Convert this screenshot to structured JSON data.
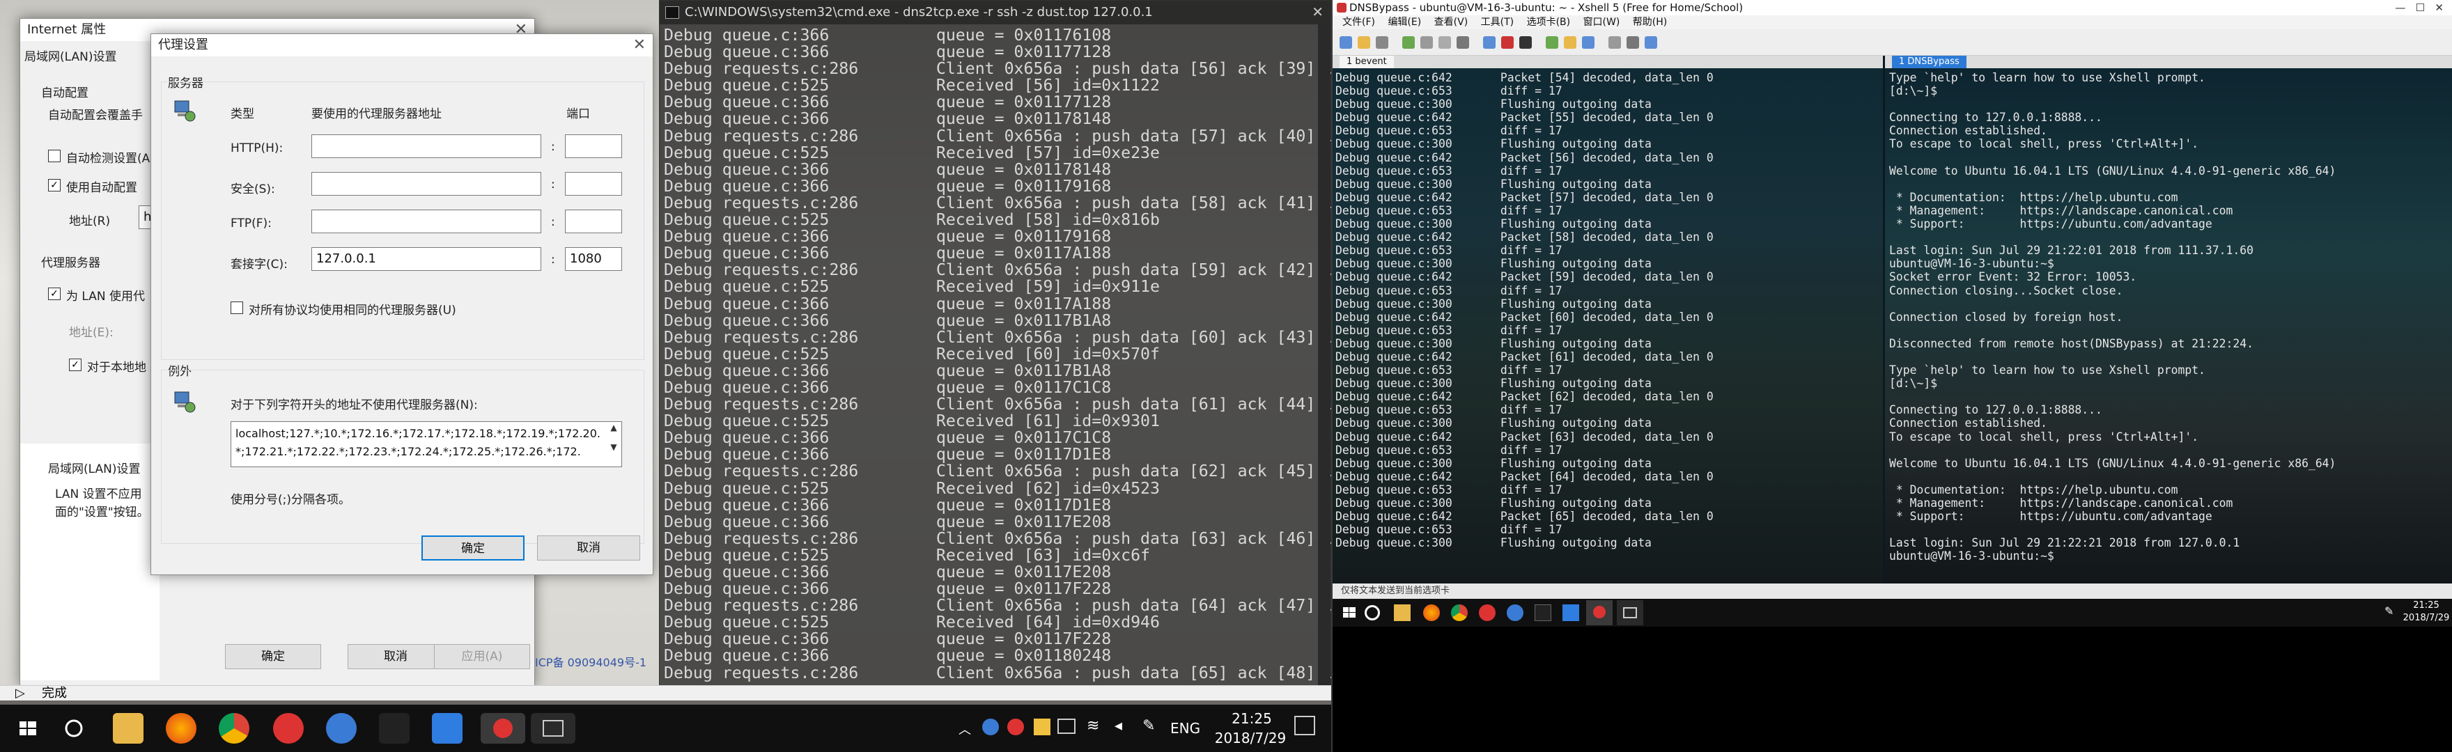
{
  "ie_window": {
    "title": "Internet 属性",
    "lan_title": "局域网(LAN)设置",
    "auto_config": "自动配置",
    "auto_config_desc": "自动配置会覆盖手",
    "auto_detect": "自动检测设置(A",
    "use_script": "使用自动配置",
    "address_label": "地址(R)",
    "address_value": "h",
    "proxy_server": "代理服务器",
    "use_proxy_lan": "为 LAN 使用代",
    "address2_label": "地址(E):",
    "local_bypass": "对于本地地",
    "lan_settings_label": "局域网(LAN)设置",
    "lan_note1": "LAN 设置不应用",
    "lan_note2": "面的\"设置\"按钮。",
    "ok": "确定",
    "cancel": "取消",
    "apply": "应用(A)",
    "icp": "ICP备 09094049号-1",
    "status_done": "完成"
  },
  "proxy_dialog": {
    "title": "代理设置",
    "servers_group": "服务器",
    "col_type": "类型",
    "col_address": "要使用的代理服务器地址",
    "col_port": "端口",
    "rows": [
      {
        "label": "HTTP(H):",
        "address": "",
        "port": ""
      },
      {
        "label": "安全(S):",
        "address": "",
        "port": ""
      },
      {
        "label": "FTP(F):",
        "address": "",
        "port": ""
      },
      {
        "label": "套接字(C):",
        "address": "127.0.0.1",
        "port": "1080"
      }
    ],
    "same_proxy_all": "对所有协议均使用相同的代理服务器(U)",
    "exceptions_group": "例外",
    "exceptions_desc": "对于下列字符开头的地址不使用代理服务器(N):",
    "exceptions_value": "localhost;127.*;10.*;172.16.*;172.17.*;172.18.*;172.19.*;172.20.*;172.21.*;172.22.*;172.23.*;172.24.*;172.25.*;172.26.*;172.",
    "separator_note": "使用分号(;)分隔各项。",
    "ok": "确定",
    "cancel": "取消"
  },
  "cmd": {
    "title": "C:\\WINDOWS\\system32\\cmd.exe - dns2tcp.exe -r ssh -z dust.top 127.0.0.1",
    "lines": [
      "Debug queue.c:366           queue = 0x01176108",
      "Debug queue.c:366           queue = 0x01177128",
      "Debug requests.c:286        Client 0x656a : push data [56] ack [39] len = 0",
      "Debug queue.c:525           Received [56] id=0x1122",
      "Debug queue.c:366           queue = 0x01177128",
      "Debug queue.c:366           queue = 0x01178148",
      "Debug requests.c:286        Client 0x656a : push data [57] ack [40] len = 0",
      "Debug queue.c:525           Received [57] id=0xe23e",
      "Debug queue.c:366           queue = 0x01178148",
      "Debug queue.c:366           queue = 0x01179168",
      "Debug requests.c:286        Client 0x656a : push data [58] ack [41] len = 0",
      "Debug queue.c:525           Received [58] id=0x816b",
      "Debug queue.c:366           queue = 0x01179168",
      "Debug queue.c:366           queue = 0x0117A188",
      "Debug requests.c:286        Client 0x656a : push data [59] ack [42] len = 0",
      "Debug queue.c:525           Received [59] id=0x911e",
      "Debug queue.c:366           queue = 0x0117A188",
      "Debug queue.c:366           queue = 0x0117B1A8",
      "Debug requests.c:286        Client 0x656a : push data [60] ack [43] len = 0",
      "Debug queue.c:525           Received [60] id=0x570f",
      "Debug queue.c:366           queue = 0x0117B1A8",
      "Debug queue.c:366           queue = 0x0117C1C8",
      "Debug requests.c:286        Client 0x656a : push data [61] ack [44] len = 0",
      "Debug queue.c:525           Received [61] id=0x9301",
      "Debug queue.c:366           queue = 0x0117C1C8",
      "Debug queue.c:366           queue = 0x0117D1E8",
      "Debug requests.c:286        Client 0x656a : push data [62] ack [45] len = 0",
      "Debug queue.c:525           Received [62] id=0x4523",
      "Debug queue.c:366           queue = 0x0117D1E8",
      "Debug queue.c:366           queue = 0x0117E208",
      "Debug requests.c:286        Client 0x656a : push data [63] ack [46] len = 0",
      "Debug queue.c:525           Received [63] id=0xc6f",
      "Debug queue.c:366           queue = 0x0117E208",
      "Debug queue.c:366           queue = 0x0117F228",
      "Debug requests.c:286        Client 0x656a : push data [64] ack [47] len = 0",
      "Debug queue.c:525           Received [64] id=0xd946",
      "Debug queue.c:366           queue = 0x0117F228",
      "Debug queue.c:366           queue = 0x01180248",
      "Debug requests.c:286        Client 0x656a : push data [65] ack [48] len = 0"
    ]
  },
  "xshell": {
    "title": "DNSBypass - ubuntu@VM-16-3-ubuntu: ~ - Xshell 5 (Free for Home/School)",
    "menu": [
      "文件(F)",
      "编辑(E)",
      "查看(V)",
      "工具(T)",
      "选项卡(B)",
      "窗口(W)",
      "帮助(H)"
    ],
    "tab_left": "1 bevent",
    "tab_right": "1 DNSBypass",
    "status": "仅将文本发送到当前选项卡",
    "left_lines": [
      "Debug queue.c:642       Packet [54] decoded, data_len 0",
      "Debug queue.c:653       diff = 17",
      "Debug queue.c:300       Flushing outgoing data",
      "Debug queue.c:642       Packet [55] decoded, data_len 0",
      "Debug queue.c:653       diff = 17",
      "Debug queue.c:300       Flushing outgoing data",
      "Debug queue.c:642       Packet [56] decoded, data_len 0",
      "Debug queue.c:653       diff = 17",
      "Debug queue.c:300       Flushing outgoing data",
      "Debug queue.c:642       Packet [57] decoded, data_len 0",
      "Debug queue.c:653       diff = 17",
      "Debug queue.c:300       Flushing outgoing data",
      "Debug queue.c:642       Packet [58] decoded, data_len 0",
      "Debug queue.c:653       diff = 17",
      "Debug queue.c:300       Flushing outgoing data",
      "Debug queue.c:642       Packet [59] decoded, data_len 0",
      "Debug queue.c:653       diff = 17",
      "Debug queue.c:300       Flushing outgoing data",
      "Debug queue.c:642       Packet [60] decoded, data_len 0",
      "Debug queue.c:653       diff = 17",
      "Debug queue.c:300       Flushing outgoing data",
      "Debug queue.c:642       Packet [61] decoded, data_len 0",
      "Debug queue.c:653       diff = 17",
      "Debug queue.c:300       Flushing outgoing data",
      "Debug queue.c:642       Packet [62] decoded, data_len 0",
      "Debug queue.c:653       diff = 17",
      "Debug queue.c:300       Flushing outgoing data",
      "Debug queue.c:642       Packet [63] decoded, data_len 0",
      "Debug queue.c:653       diff = 17",
      "Debug queue.c:300       Flushing outgoing data",
      "Debug queue.c:642       Packet [64] decoded, data_len 0",
      "Debug queue.c:653       diff = 17",
      "Debug queue.c:300       Flushing outgoing data",
      "Debug queue.c:642       Packet [65] decoded, data_len 0",
      "Debug queue.c:653       diff = 17",
      "Debug queue.c:300       Flushing outgoing data"
    ],
    "right_lines": [
      "Type `help' to learn how to use Xshell prompt.",
      "[d:\\~]$",
      "",
      "Connecting to 127.0.0.1:8888...",
      "Connection established.",
      "To escape to local shell, press 'Ctrl+Alt+]'.",
      "",
      "Welcome to Ubuntu 16.04.1 LTS (GNU/Linux 4.4.0-91-generic x86_64)",
      "",
      " * Documentation:  https://help.ubuntu.com",
      " * Management:     https://landscape.canonical.com",
      " * Support:        https://ubuntu.com/advantage",
      "",
      "Last login: Sun Jul 29 21:22:01 2018 from 111.37.1.60",
      "ubuntu@VM-16-3-ubuntu:~$",
      "Socket error Event: 32 Error: 10053.",
      "Connection closing...Socket close.",
      "",
      "Connection closed by foreign host.",
      "",
      "Disconnected from remote host(DNSBypass) at 21:22:24.",
      "",
      "Type `help' to learn how to use Xshell prompt.",
      "[d:\\~]$",
      "",
      "Connecting to 127.0.0.1:8888...",
      "Connection established.",
      "To escape to local shell, press 'Ctrl+Alt+]'.",
      "",
      "Welcome to Ubuntu 16.04.1 LTS (GNU/Linux 4.4.0-91-generic x86_64)",
      "",
      " * Documentation:  https://help.ubuntu.com",
      " * Management:     https://landscape.canonical.com",
      " * Support:        https://ubuntu.com/advantage",
      "",
      "Last login: Sun Jul 29 21:22:21 2018 from 127.0.0.1",
      "ubuntu@VM-16-3-ubuntu:~$"
    ]
  },
  "taskbar_left": {
    "lang": "ENG",
    "time": "21:25",
    "date": "2018/7/29",
    "icons": [
      "windows-start-icon",
      "cortana-icon",
      "file-explorer-icon",
      "firefox-icon",
      "chrome-icon",
      "netease-music-icon",
      "app-s-icon",
      "qq-icon",
      "app-blue-icon",
      "app-red-icon",
      "terminal-icon"
    ]
  },
  "taskbar_right": {
    "time": "21:25",
    "date": "2018/7/29"
  }
}
